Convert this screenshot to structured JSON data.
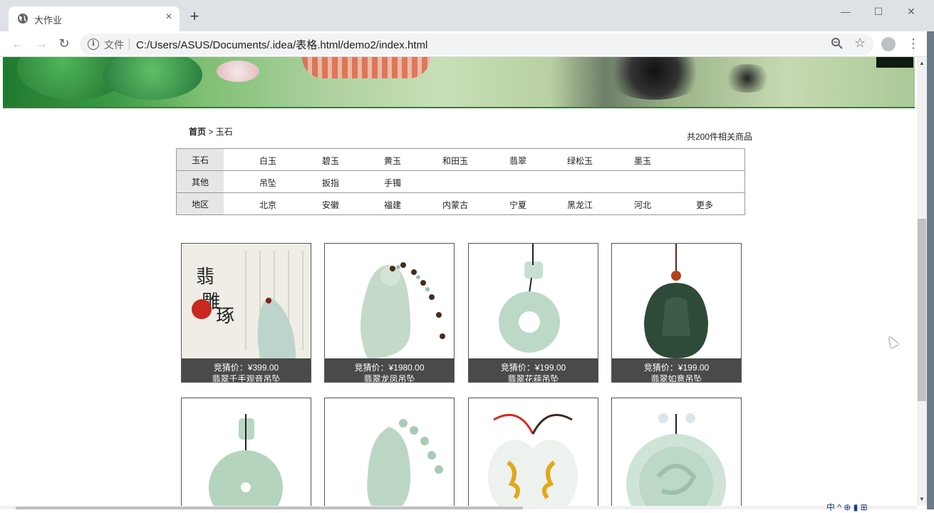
{
  "browser": {
    "tab_title": "大作业",
    "tab_close": "×",
    "new_tab": "+",
    "address_label": "文件",
    "url": "C:/Users/ASUS/Documents/.idea/表格.html/demo2/index.html",
    "window": {
      "minimize": "—",
      "maximize": "☐",
      "close": "✕"
    },
    "nav": {
      "back": "←",
      "forward": "→",
      "reload": "↻"
    },
    "menu": "⋮",
    "star": "☆"
  },
  "breadcrumb": {
    "home": "首页",
    "sep": ">",
    "current": "玉石"
  },
  "result_count": "共200件相关商品",
  "filters": [
    {
      "label": "玉石",
      "options": [
        "白玉",
        "碧玉",
        "黄玉",
        "和田玉",
        "翡翠",
        "绿松玉",
        "墨玉"
      ]
    },
    {
      "label": "其他",
      "options": [
        "吊坠",
        "扳指",
        "手镯"
      ]
    },
    {
      "label": "地区",
      "options": [
        "北京",
        "安徽",
        "福建",
        "内蒙古",
        "宁夏",
        "黑龙江",
        "河北",
        "更多"
      ]
    }
  ],
  "products": [
    {
      "price": "竞猜价：¥399.00",
      "name": "翡翠千手观音吊坠",
      "image": "guanyin-pendant-image"
    },
    {
      "price": "竞猜价：¥1980.00",
      "name": "翡翠龙凤吊坠",
      "image": "buddha-pendant-image"
    },
    {
      "price": "竞猜价：¥199.00",
      "name": "翡翠花莼吊坠",
      "image": "donut-pendant-image"
    },
    {
      "price": "竞猜价：¥199.00",
      "name": "翡翠如意吊坠",
      "image": "dark-jade-pendant-image"
    }
  ],
  "icons": {
    "globe": "globe-icon",
    "info": "info-icon",
    "zoom": "zoom-icon",
    "profile": "profile-icon"
  },
  "colors": {
    "caption_bg": "#4a4a4a",
    "label_bg": "#e6e6e6",
    "banner_green": "#3a9a45"
  },
  "tray": "中 ^ ⊕ ▮ ⊞"
}
